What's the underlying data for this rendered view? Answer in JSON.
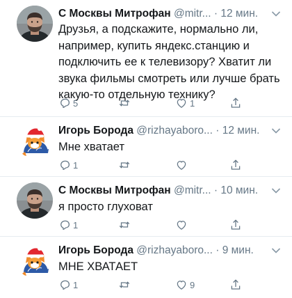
{
  "tweets": [
    {
      "author": "С Москвы Митрофан",
      "handle": "@mitr...",
      "time": "· 12 мин.",
      "text": "Друзья, а подскажите, нормально ли, например, купить яндекс.станцию и подключить ее к телевизору? Хватит ли звука фильмы смотреть или лучше брать какую-то отдельную технику?",
      "replies": "5",
      "retweets": "",
      "likes": "1",
      "avatar_icon": "man-photo-avatar-icon"
    },
    {
      "author": "Игорь Борода",
      "handle": "@rizhayaboro...",
      "time": "· 12 мин.",
      "text": "Мне хватает",
      "replies": "1",
      "retweets": "",
      "likes": "",
      "avatar_icon": "christmas-fox-avatar-icon"
    },
    {
      "author": "С Москвы Митрофан",
      "handle": "@mitr...",
      "time": "· 10 мин.",
      "text": "я просто глуховат",
      "replies": "1",
      "retweets": "",
      "likes": "",
      "avatar_icon": "man-photo-avatar-icon"
    },
    {
      "author": "Игорь Борода",
      "handle": "@rizhayaboro...",
      "time": "· 9 мин.",
      "text": "МНЕ ХВАТАЕТ",
      "replies": "1",
      "retweets": "",
      "likes": "9",
      "avatar_icon": "christmas-fox-avatar-icon"
    }
  ],
  "colors": {
    "text": "#14171a",
    "secondary": "#657786",
    "divider": "#e6ecf0"
  }
}
